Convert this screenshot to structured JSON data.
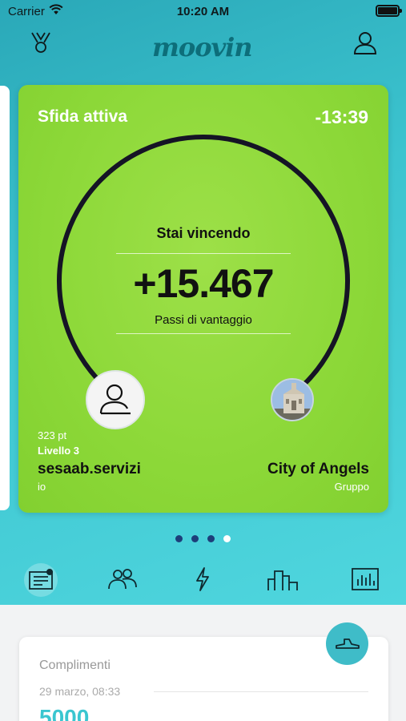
{
  "status_bar": {
    "carrier": "Carrier",
    "time": "10:20 AM"
  },
  "header": {
    "logo": "moovin",
    "left_icon": "medal-icon",
    "right_icon": "user-icon"
  },
  "card": {
    "title": "Sfida attiva",
    "timer": "-13:39",
    "status": "Stai vincendo",
    "advantage": "+15.467",
    "advantage_label": "Passi di vantaggio",
    "me": {
      "points": "323 pt",
      "level": "Livello 3",
      "name": "sesaab.servizi",
      "role": "io"
    },
    "opponent": {
      "name": "City of Angels",
      "role": "Gruppo"
    },
    "ring_progress": 0.8
  },
  "pager": {
    "count": 4,
    "active_index": 3
  },
  "tabs": [
    {
      "icon": "news-icon",
      "selected": true
    },
    {
      "icon": "group-icon",
      "selected": false
    },
    {
      "icon": "lightning-icon",
      "selected": false
    },
    {
      "icon": "city-icon",
      "selected": false
    },
    {
      "icon": "stats-icon",
      "selected": false
    }
  ],
  "feed": {
    "title": "Complimenti",
    "date": "29 marzo, 08:33",
    "value": "5000",
    "badge_icon": "shoe-icon"
  },
  "colors": {
    "card_green": "#8cd838",
    "accent_teal": "#3ac6d0",
    "dot_dark": "#1d3e7a"
  }
}
